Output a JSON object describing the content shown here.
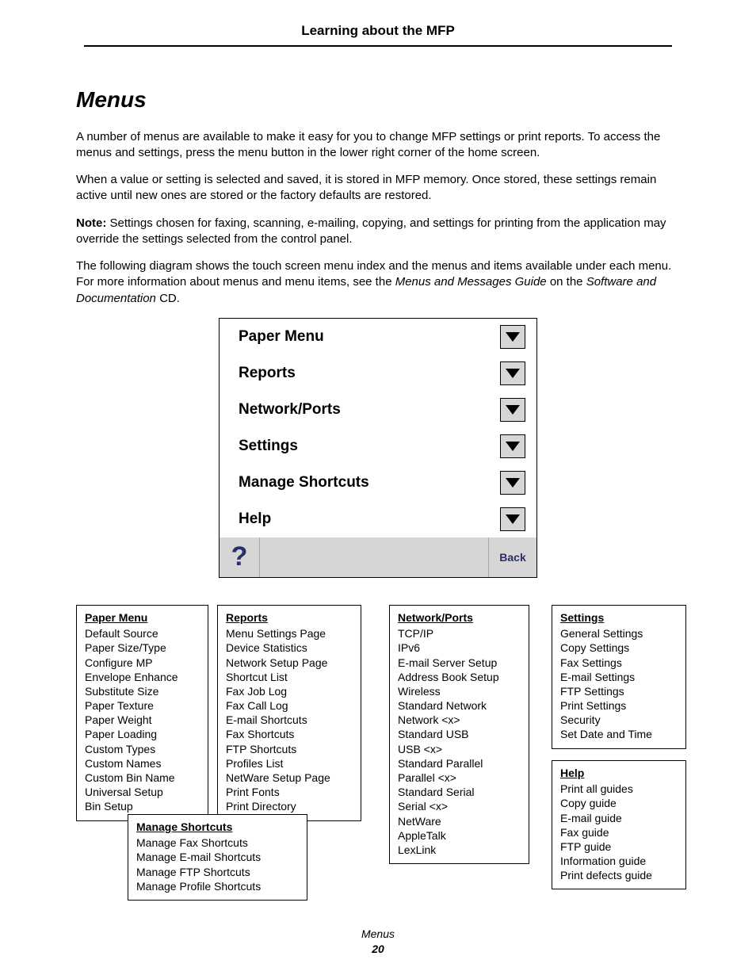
{
  "running_head": "Learning about the MFP",
  "section_title": "Menus",
  "para1": "A number of menus are available to make it easy for you to change MFP settings or print reports. To access the menus and settings, press the menu button in the lower right corner of the home screen.",
  "para2": "When a value or setting is selected and saved, it is stored in MFP memory. Once stored, these settings remain active until new ones are stored or the factory defaults are restored.",
  "note_label": "Note:",
  "note_text": "Settings chosen for faxing, scanning, e-mailing, copying, and settings for printing from the application may override the settings selected from the control panel.",
  "para3_a": "The following diagram shows the touch screen menu index and the menus and items available under each menu. For more information about menus and menu items, see the ",
  "para3_b": "Menus and Messages Guide",
  "para3_c": " on the ",
  "para3_d": "Software and Documentation",
  "para3_e": " CD.",
  "touchscreen": {
    "items": [
      "Paper Menu",
      "Reports",
      "Network/Ports",
      "Settings",
      "Manage Shortcuts",
      "Help"
    ],
    "help_glyph": "?",
    "back_label": "Back"
  },
  "boxes": {
    "paper": {
      "title": "Paper Menu",
      "items": [
        "Default Source",
        "Paper Size/Type",
        "Configure MP",
        "Envelope Enhance",
        "Substitute Size",
        "Paper Texture",
        "Paper Weight",
        "Paper Loading",
        "Custom Types",
        "Custom Names",
        "Custom Bin Name",
        "Universal Setup",
        "Bin Setup"
      ]
    },
    "reports": {
      "title": "Reports",
      "items": [
        "Menu Settings Page",
        "Device Statistics",
        "Network Setup Page",
        "Shortcut List",
        "Fax Job Log",
        "Fax Call Log",
        "E-mail Shortcuts",
        "Fax Shortcuts",
        "FTP Shortcuts",
        "Profiles List",
        "NetWare Setup Page",
        "Print Fonts",
        "Print Directory"
      ]
    },
    "network": {
      "title": "Network/Ports",
      "items": [
        "TCP/IP",
        "IPv6",
        "E-mail Server Setup",
        "Address Book Setup",
        "Wireless",
        "Standard Network",
        "Network <x>",
        "Standard USB",
        "USB <x>",
        "Standard Parallel",
        "Parallel <x>",
        "Standard Serial",
        "Serial <x>",
        "NetWare",
        "AppleTalk",
        "LexLink"
      ]
    },
    "settings": {
      "title": "Settings",
      "items": [
        "General Settings",
        "Copy Settings",
        "Fax Settings",
        "E-mail Settings",
        "FTP Settings",
        "Print Settings",
        "Security",
        "Set Date and Time"
      ]
    },
    "help": {
      "title": "Help",
      "items": [
        "Print all guides",
        "Copy guide",
        "E-mail guide",
        "Fax guide",
        "FTP guide",
        "Information guide",
        "Print defects guide"
      ]
    },
    "shortcuts": {
      "title": "Manage Shortcuts",
      "items": [
        "Manage Fax Shortcuts",
        "Manage E-mail Shortcuts",
        "Manage FTP Shortcuts",
        "Manage Profile Shortcuts"
      ]
    }
  },
  "footer_title": "Menus",
  "footer_page": "20"
}
